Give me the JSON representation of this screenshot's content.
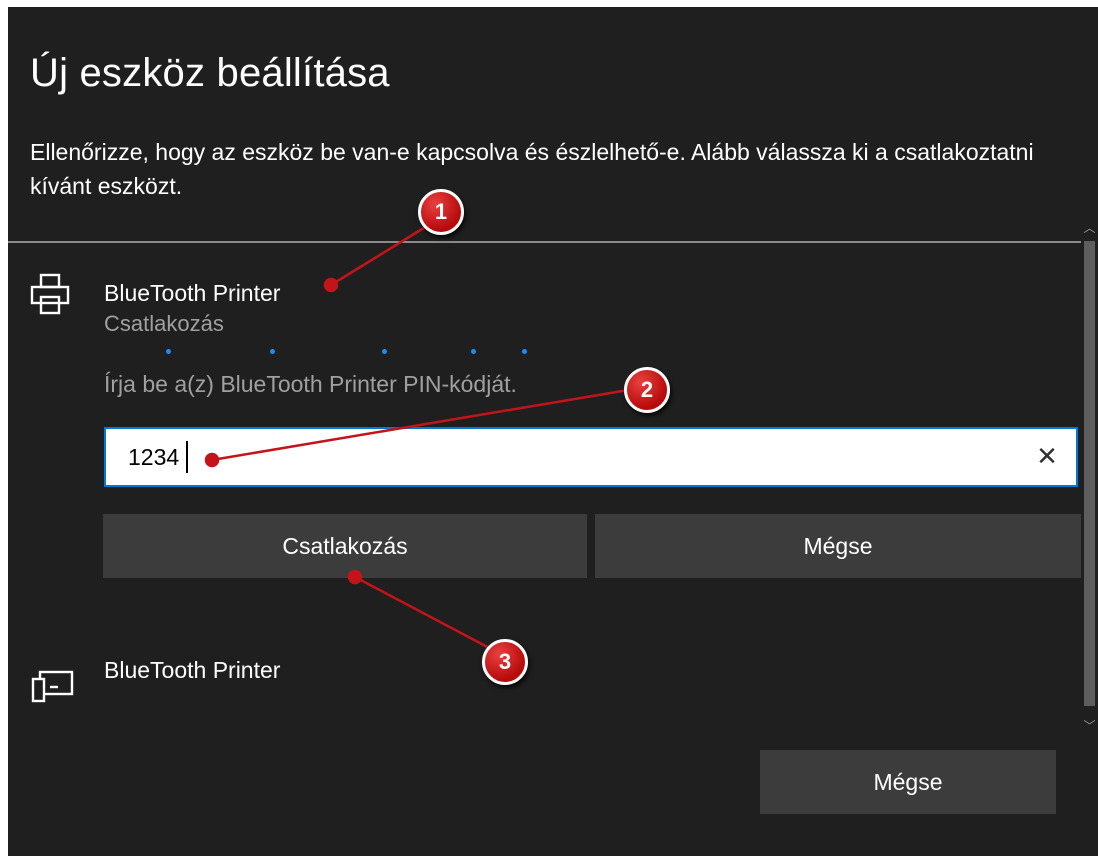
{
  "dialog": {
    "title": "Új eszköz beállítása",
    "instructions": "Ellenőrizze, hogy az eszköz be van-e kapcsolva és észlelhető-e. Alább válassza ki a csatlakoztatni kívánt eszközt."
  },
  "devices": [
    {
      "name": "BlueTooth Printer",
      "icon": "printer-icon",
      "status": "Csatlakozás",
      "pin_prompt": "Írja be a(z) BlueTooth Printer PIN-kódját.",
      "pin_value": "1234",
      "connect_label": "Csatlakozás",
      "cancel_label": "Mégse"
    },
    {
      "name": "BlueTooth Printer",
      "icon": "device-icon"
    }
  ],
  "footer": {
    "cancel_label": "Mégse"
  },
  "annotations": [
    "1",
    "2",
    "3"
  ],
  "colors": {
    "dialog_bg": "#1f1f1f",
    "accent": "#0078d7",
    "button_bg": "#3c3c3c",
    "annotation_red": "#c4141a"
  }
}
